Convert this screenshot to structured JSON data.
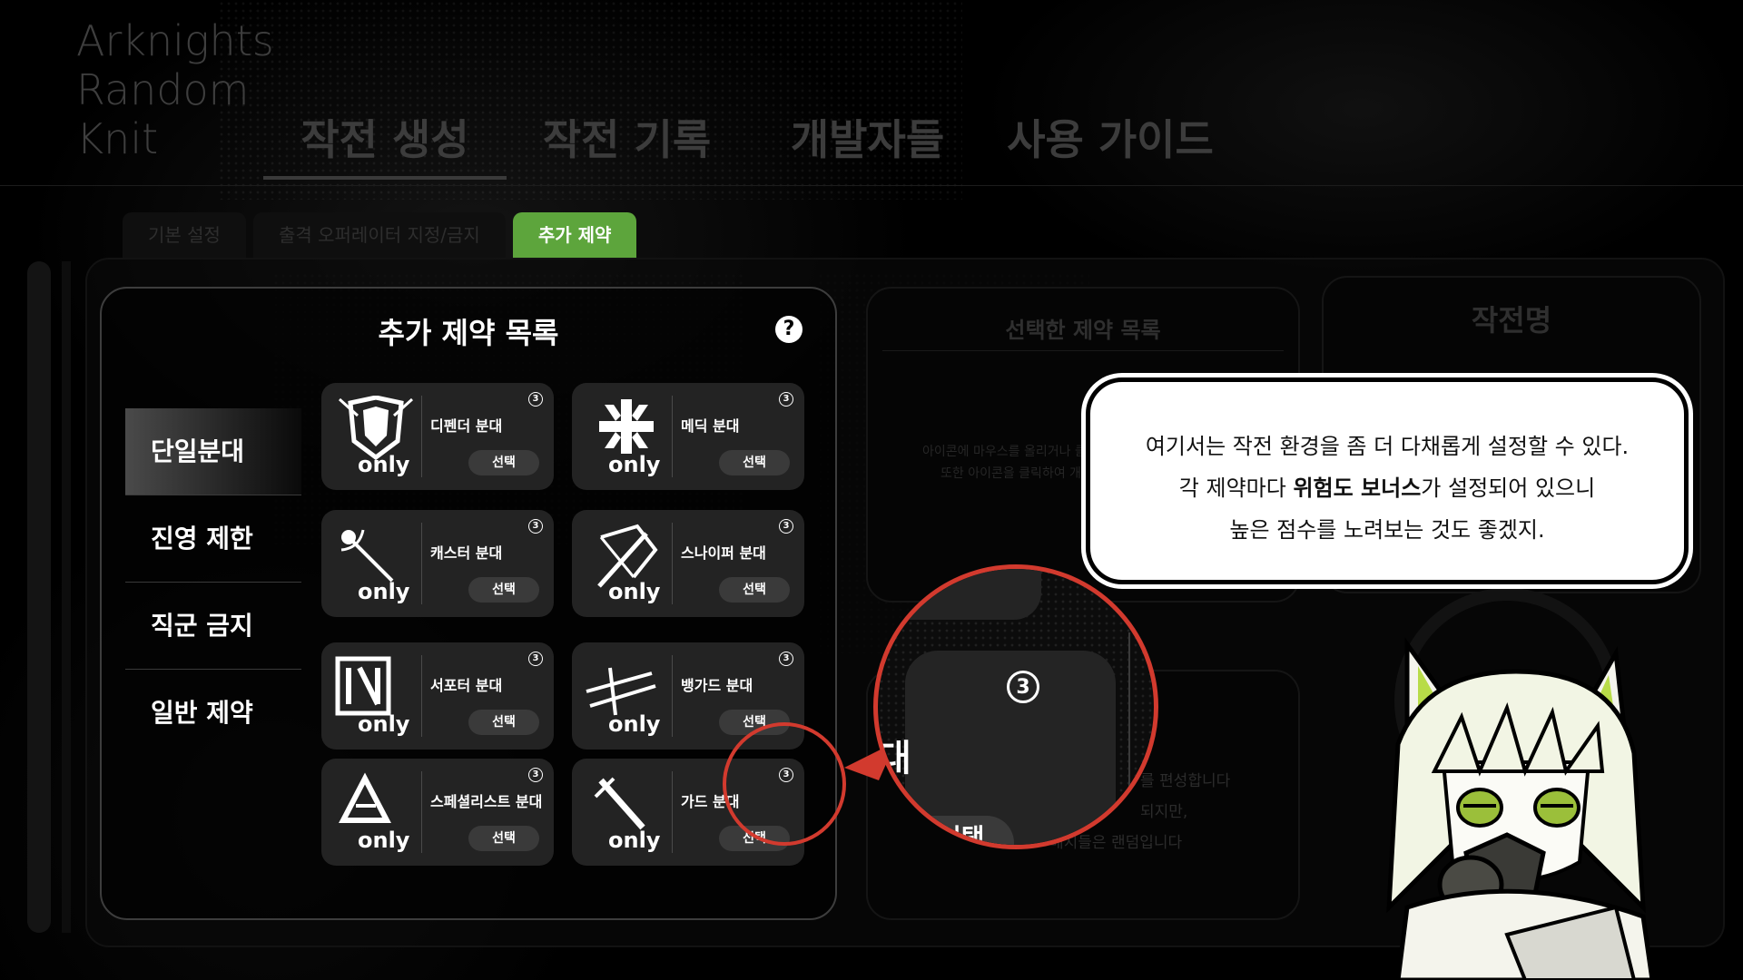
{
  "logo": {
    "line1": "Arknights",
    "line2": "Random",
    "line3": "Knit"
  },
  "nav": {
    "items": [
      "작전 생성",
      "작전 기록",
      "개발자들",
      "사용 가이드"
    ]
  },
  "subtabs": [
    "기본 설정",
    "출격 오퍼레이터 지정/금지",
    "추가 제약"
  ],
  "panel": {
    "title": "추가 제약 목록",
    "help": "?",
    "categories": [
      "단일분대",
      "진영 제한",
      "직군 금지",
      "일반 제약"
    ],
    "cards": [
      {
        "name": "디펜더 분대",
        "select": "선택",
        "badge": "3",
        "only": "only",
        "icon": "defender-shield-icon"
      },
      {
        "name": "메딕 분대",
        "select": "선택",
        "badge": "3",
        "only": "only",
        "icon": "medic-cross-icon"
      },
      {
        "name": "캐스터 분대",
        "select": "선택",
        "badge": "3",
        "only": "only",
        "icon": "caster-staff-icon"
      },
      {
        "name": "스나이퍼 분대",
        "select": "선택",
        "badge": "3",
        "only": "only",
        "icon": "sniper-crossbow-icon"
      },
      {
        "name": "서포터 분대",
        "select": "선택",
        "badge": "3",
        "only": "only",
        "icon": "supporter-icon"
      },
      {
        "name": "뱅가드 분대",
        "select": "선택",
        "badge": "3",
        "only": "only",
        "icon": "vanguard-icon"
      },
      {
        "name": "스페셜리스트 분대",
        "select": "선택",
        "badge": "3",
        "only": "only",
        "icon": "specialist-icon"
      },
      {
        "name": "가드 분대",
        "select": "선택",
        "badge": "3",
        "only": "only",
        "icon": "guard-sword-icon"
      }
    ]
  },
  "selected_panel": {
    "title": "선택한 제약 목록",
    "hint1": "아이콘에 마우스를 올리거나 클",
    "hint2": "또한 아이콘을 클릭하여 개별"
  },
  "operation_panel": {
    "title": "작전명"
  },
  "lower_panel": {
    "line1": "를 편성합니다",
    "line2": "되지만,",
    "line3": "배치들은 랜덤입니다"
  },
  "zoom": {
    "badge": "3",
    "text": "대",
    "select": "선택"
  },
  "bubble": {
    "line1": "여기서는 작전 환경을 좀 더 다채롭게 설정할 수 있다.",
    "line2_pre": "각 제약마다 ",
    "line2_bold": "위험도 보너스",
    "line2_post": "가 설정되어 있으니",
    "line3": "높은 점수를 노려보는 것도 좋겠지."
  },
  "colors": {
    "accent": "#5da53c",
    "highlight": "#d23a2e"
  }
}
